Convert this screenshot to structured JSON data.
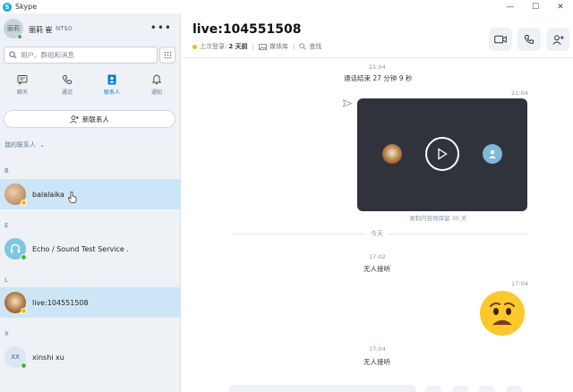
{
  "window": {
    "app_title": "Skype",
    "controls": [
      "—",
      "☐",
      "✕"
    ]
  },
  "profile": {
    "avatar_initials": "丽莉",
    "name": "丽莉 崔",
    "credit": "NT$0"
  },
  "search": {
    "placeholder": "用户、群组和消息"
  },
  "nav": {
    "tabs": [
      {
        "label": "聊天",
        "icon": "chat-icon",
        "active": false
      },
      {
        "label": "通话",
        "icon": "phone-icon",
        "active": false
      },
      {
        "label": "联系人",
        "icon": "contacts-icon",
        "active": true
      },
      {
        "label": "通知",
        "icon": "bell-icon",
        "active": false
      }
    ]
  },
  "new_contact": {
    "label": "新联系人"
  },
  "contacts_header": {
    "label": "我的联系人"
  },
  "contacts": {
    "groups": [
      {
        "letter": "B",
        "name": "balalaika",
        "avatar": "photo",
        "status": "away",
        "selected": true
      },
      {
        "letter": "E",
        "name": "Echo / Sound Test Service .",
        "avatar": "headset-icon",
        "status": "online",
        "selected": false
      },
      {
        "letter": "L",
        "name": "live:104551508",
        "avatar": "photo",
        "status": "away",
        "selected": true
      },
      {
        "letter": "X",
        "name": "xinshi xu",
        "avatar": "XX",
        "status": "online",
        "selected": false
      }
    ]
  },
  "conversation": {
    "title": "live:104551508",
    "last_seen_prefix": "上次登录:",
    "last_seen_value": "2 天前",
    "media_label": "媒体库",
    "find_label": "查找",
    "status_color": "#f8b700"
  },
  "messages": {
    "call_end_time": "21:04",
    "call_end_text": "通话结束 27 分钟 9 秒",
    "video_time": "21:04",
    "retention_text": "录制内容将保留 30 天",
    "divider_label": "今天",
    "missed1_time": "17:02",
    "missed1_text": "无人接听",
    "emoji_time": "17:04",
    "missed2_time": "17:04",
    "missed2_text": "无人接听"
  },
  "colors": {
    "accent": "#0078d4",
    "sidebar_bg": "#eef2f7",
    "selected_row": "#cde6f7",
    "video_bg": "#30323c",
    "online": "#3aba3a",
    "away": "#f8b700"
  }
}
